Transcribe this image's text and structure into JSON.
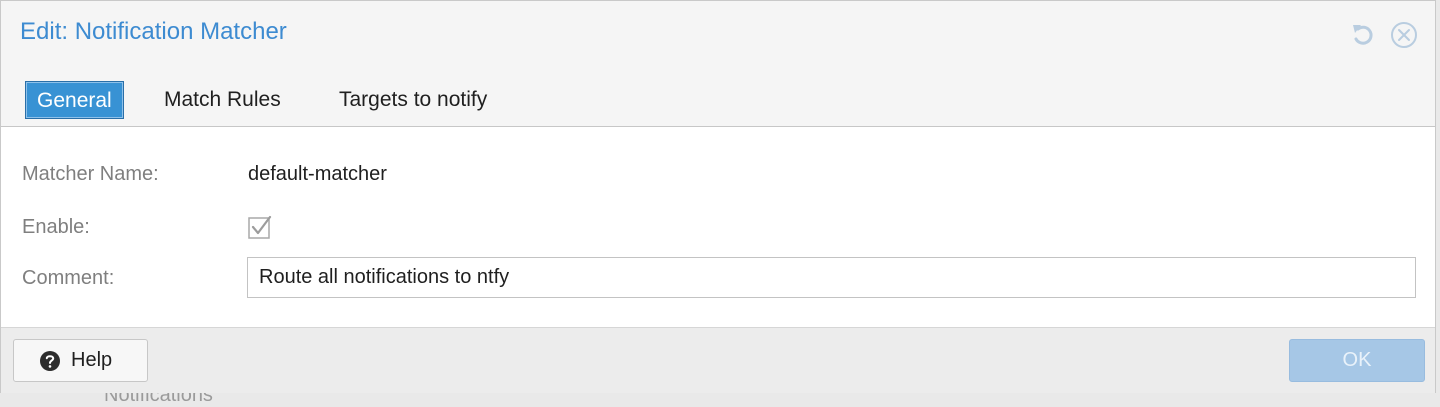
{
  "dialog": {
    "title": "Edit: Notification Matcher",
    "tool_icons": [
      "reset-icon",
      "close-icon"
    ]
  },
  "tabs": [
    {
      "label": "General",
      "active": true
    },
    {
      "label": "Match Rules",
      "active": false
    },
    {
      "label": "Targets to notify",
      "active": false
    }
  ],
  "form": {
    "matcher_name": {
      "label": "Matcher Name:",
      "value": "default-matcher"
    },
    "enable": {
      "label": "Enable:",
      "checked": true
    },
    "comment": {
      "label": "Comment:",
      "value": "Route all notifications to ntfy"
    }
  },
  "footer": {
    "help_label": "Help",
    "help_icon": "help-icon",
    "ok_label": "OK",
    "ok_disabled": true
  },
  "background": {
    "partial_text": "Notifications"
  },
  "colors": {
    "accent": "#3892d4",
    "title": "#3d8bd1",
    "ok_disabled_bg": "#a6c7e6"
  }
}
